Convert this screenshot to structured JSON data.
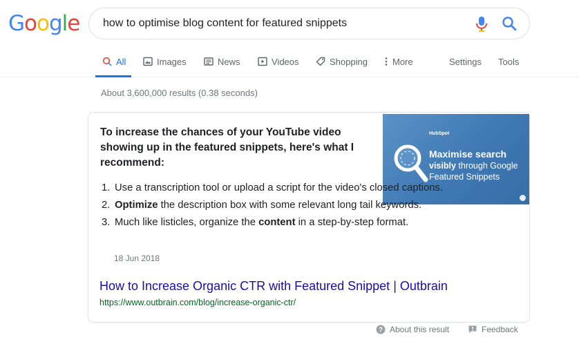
{
  "logo": {
    "letters": [
      "G",
      "o",
      "o",
      "g",
      "l",
      "e"
    ],
    "colors": [
      "#4285f4",
      "#ea4335",
      "#fbbc05",
      "#4285f4",
      "#34a853",
      "#ea4335"
    ]
  },
  "search": {
    "query": "how to optimise blog content for featured snippets",
    "icons": [
      "microphone-icon",
      "search-icon"
    ]
  },
  "tabs": [
    {
      "label": "All",
      "icon": "search-icon",
      "active": true
    },
    {
      "label": "Images",
      "icon": "image-icon"
    },
    {
      "label": "News",
      "icon": "newspaper-icon"
    },
    {
      "label": "Videos",
      "icon": "play-icon"
    },
    {
      "label": "Shopping",
      "icon": "tag-icon"
    },
    {
      "label": "More",
      "icon": "vertical-dots-icon"
    },
    {
      "label": "Settings"
    },
    {
      "label": "Tools"
    }
  ],
  "stats": "About 3,600,000 results (0.38 seconds)",
  "snippet": {
    "headline": "To increase the chances of your YouTube video showing up in the featured snippets, here's what I recommend:",
    "thumbnail": {
      "brand": "HubSpot",
      "line1": "Maximise search",
      "line2_bold": "visibly",
      "line2_rest": " through Google",
      "line3": "Featured Snippets"
    },
    "steps": [
      {
        "num": "1.",
        "pre": "Use a transcription tool or upload a script for the video's closed captions.",
        "bold": "",
        "post": ""
      },
      {
        "num": "2.",
        "pre": "",
        "bold": "Optimize",
        "post": " the description box with some relevant long tail keywords."
      },
      {
        "num": "3.",
        "pre": "Much like listicles, organize the ",
        "bold": "content",
        "post": " in a step-by-step format."
      }
    ],
    "date": "18 Jun 2018",
    "title": "How to Increase Organic CTR with Featured Snippet | Outbrain",
    "url": "https://www.outbrain.com/blog/increase-organic-ctr/"
  },
  "footer": {
    "about": "About this result",
    "feedback": "Feedback"
  },
  "colors": {
    "accent": "#1a73e8",
    "link": "#1a0dab",
    "url": "#006621"
  }
}
